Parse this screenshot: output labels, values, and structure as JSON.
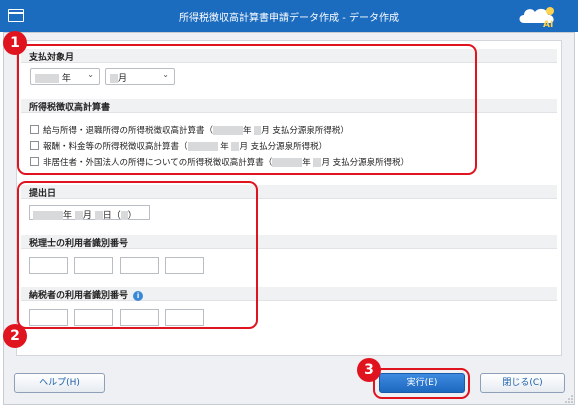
{
  "window": {
    "title": "所得税徴収高計算書申請データ作成 - データ作成"
  },
  "sections": {
    "period": {
      "heading": "支払対象月",
      "year_suffix": "年",
      "month_suffix": "月"
    },
    "statements": {
      "heading": "所得税徴収高計算書",
      "items": [
        {
          "label_a": "給与所得・退職所得の所得税徴収高計算書（",
          "year": "年",
          "month": "月 支払分源泉所得税）"
        },
        {
          "label_a": "報酬・料金等の所得税徴収高計算書（",
          "year": "年",
          "month": "月 支払分源泉所得税）"
        },
        {
          "label_a": "非居住者・外国法人の所得についての所得税徴収高計算書（",
          "year": "年",
          "month": "月 支払分源泉所得税）"
        }
      ]
    },
    "submission": {
      "heading": "提出日",
      "year": "年",
      "month": "月",
      "day": "日（",
      "close": "）"
    },
    "accountant_id": {
      "heading": "税理士の利用者識別番号"
    },
    "taxpayer_id": {
      "heading": "納税者の利用者識別番号",
      "info_glyph": "i"
    }
  },
  "buttons": {
    "help": "ヘルプ(H)",
    "execute": "実行(E)",
    "close": "閉じる(C)"
  },
  "annotations": [
    "1",
    "2",
    "3"
  ],
  "colors": {
    "titlebar": "#1b6bbf",
    "highlight": "#e0141e",
    "accent": "#1e68c0"
  }
}
